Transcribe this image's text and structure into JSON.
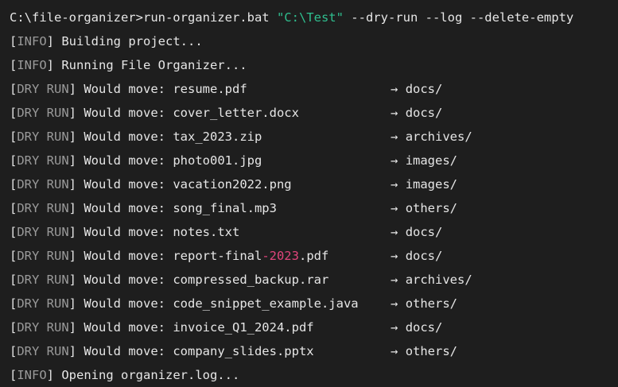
{
  "prompt": "C:\\file-organizer>",
  "command": "run-organizer.bat ",
  "command_path": "\"C:\\Test\"",
  "command_flags": " --dry-run --log --delete-empty",
  "info_tag": "INFO",
  "dry_tag": "DRY RUN",
  "info_lines": {
    "building": "Building project...",
    "running": "Running File Organizer...",
    "opening": "Opening organizer.log..."
  },
  "move_prefix": "Would move: ",
  "arrow": "→",
  "moves": [
    {
      "file": "resume.pdf",
      "dest": "docs/"
    },
    {
      "file": "cover_letter.docx",
      "dest": "docs/"
    },
    {
      "file": "tax_2023.zip",
      "dest": "archives/"
    },
    {
      "file": "photo001.jpg",
      "dest": "images/"
    },
    {
      "file": "vacation2022.png",
      "dest": "images/"
    },
    {
      "file": "song_final.mp3",
      "dest": "others/"
    },
    {
      "file": "notes.txt",
      "dest": "docs/"
    },
    {
      "file_pre": "report-final",
      "file_hl": "-2023",
      "file_post": ".pdf",
      "dest": "docs/"
    },
    {
      "file": "compressed_backup.rar",
      "dest": "archives/"
    },
    {
      "file": "code_snippet_example.java",
      "dest": "others/"
    },
    {
      "file": "invoice_Q1_2024.pdf",
      "dest": "docs/"
    },
    {
      "file": "company_slides.pptx",
      "dest": "others/"
    }
  ],
  "colors": {
    "background": "#1e1e1e",
    "text": "#e6e6e6",
    "tag": "#9a9a9a",
    "string": "#2fbf8f",
    "highlight": "#e0457b"
  }
}
